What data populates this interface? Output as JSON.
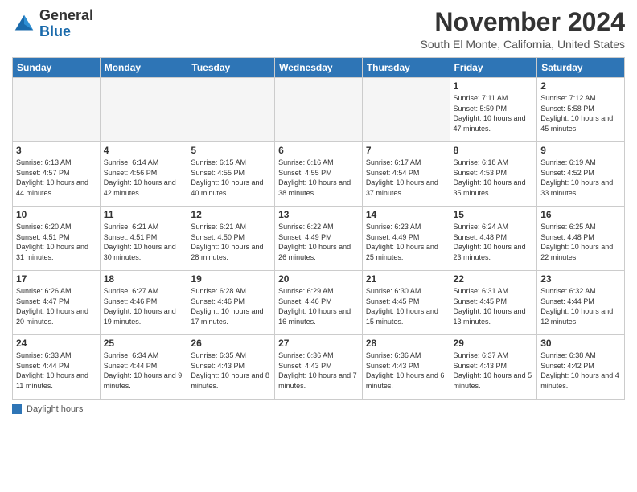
{
  "header": {
    "logo_general": "General",
    "logo_blue": "Blue",
    "month_title": "November 2024",
    "subtitle": "South El Monte, California, United States"
  },
  "calendar": {
    "days_of_week": [
      "Sunday",
      "Monday",
      "Tuesday",
      "Wednesday",
      "Thursday",
      "Friday",
      "Saturday"
    ],
    "weeks": [
      [
        {
          "day": "",
          "info": "",
          "empty": true
        },
        {
          "day": "",
          "info": "",
          "empty": true
        },
        {
          "day": "",
          "info": "",
          "empty": true
        },
        {
          "day": "",
          "info": "",
          "empty": true
        },
        {
          "day": "",
          "info": "",
          "empty": true
        },
        {
          "day": "1",
          "info": "Sunrise: 7:11 AM\nSunset: 5:59 PM\nDaylight: 10 hours and 47 minutes.",
          "empty": false
        },
        {
          "day": "2",
          "info": "Sunrise: 7:12 AM\nSunset: 5:58 PM\nDaylight: 10 hours and 45 minutes.",
          "empty": false
        }
      ],
      [
        {
          "day": "3",
          "info": "Sunrise: 6:13 AM\nSunset: 4:57 PM\nDaylight: 10 hours and 44 minutes.",
          "empty": false
        },
        {
          "day": "4",
          "info": "Sunrise: 6:14 AM\nSunset: 4:56 PM\nDaylight: 10 hours and 42 minutes.",
          "empty": false
        },
        {
          "day": "5",
          "info": "Sunrise: 6:15 AM\nSunset: 4:55 PM\nDaylight: 10 hours and 40 minutes.",
          "empty": false
        },
        {
          "day": "6",
          "info": "Sunrise: 6:16 AM\nSunset: 4:55 PM\nDaylight: 10 hours and 38 minutes.",
          "empty": false
        },
        {
          "day": "7",
          "info": "Sunrise: 6:17 AM\nSunset: 4:54 PM\nDaylight: 10 hours and 37 minutes.",
          "empty": false
        },
        {
          "day": "8",
          "info": "Sunrise: 6:18 AM\nSunset: 4:53 PM\nDaylight: 10 hours and 35 minutes.",
          "empty": false
        },
        {
          "day": "9",
          "info": "Sunrise: 6:19 AM\nSunset: 4:52 PM\nDaylight: 10 hours and 33 minutes.",
          "empty": false
        }
      ],
      [
        {
          "day": "10",
          "info": "Sunrise: 6:20 AM\nSunset: 4:51 PM\nDaylight: 10 hours and 31 minutes.",
          "empty": false
        },
        {
          "day": "11",
          "info": "Sunrise: 6:21 AM\nSunset: 4:51 PM\nDaylight: 10 hours and 30 minutes.",
          "empty": false
        },
        {
          "day": "12",
          "info": "Sunrise: 6:21 AM\nSunset: 4:50 PM\nDaylight: 10 hours and 28 minutes.",
          "empty": false
        },
        {
          "day": "13",
          "info": "Sunrise: 6:22 AM\nSunset: 4:49 PM\nDaylight: 10 hours and 26 minutes.",
          "empty": false
        },
        {
          "day": "14",
          "info": "Sunrise: 6:23 AM\nSunset: 4:49 PM\nDaylight: 10 hours and 25 minutes.",
          "empty": false
        },
        {
          "day": "15",
          "info": "Sunrise: 6:24 AM\nSunset: 4:48 PM\nDaylight: 10 hours and 23 minutes.",
          "empty": false
        },
        {
          "day": "16",
          "info": "Sunrise: 6:25 AM\nSunset: 4:48 PM\nDaylight: 10 hours and 22 minutes.",
          "empty": false
        }
      ],
      [
        {
          "day": "17",
          "info": "Sunrise: 6:26 AM\nSunset: 4:47 PM\nDaylight: 10 hours and 20 minutes.",
          "empty": false
        },
        {
          "day": "18",
          "info": "Sunrise: 6:27 AM\nSunset: 4:46 PM\nDaylight: 10 hours and 19 minutes.",
          "empty": false
        },
        {
          "day": "19",
          "info": "Sunrise: 6:28 AM\nSunset: 4:46 PM\nDaylight: 10 hours and 17 minutes.",
          "empty": false
        },
        {
          "day": "20",
          "info": "Sunrise: 6:29 AM\nSunset: 4:46 PM\nDaylight: 10 hours and 16 minutes.",
          "empty": false
        },
        {
          "day": "21",
          "info": "Sunrise: 6:30 AM\nSunset: 4:45 PM\nDaylight: 10 hours and 15 minutes.",
          "empty": false
        },
        {
          "day": "22",
          "info": "Sunrise: 6:31 AM\nSunset: 4:45 PM\nDaylight: 10 hours and 13 minutes.",
          "empty": false
        },
        {
          "day": "23",
          "info": "Sunrise: 6:32 AM\nSunset: 4:44 PM\nDaylight: 10 hours and 12 minutes.",
          "empty": false
        }
      ],
      [
        {
          "day": "24",
          "info": "Sunrise: 6:33 AM\nSunset: 4:44 PM\nDaylight: 10 hours and 11 minutes.",
          "empty": false
        },
        {
          "day": "25",
          "info": "Sunrise: 6:34 AM\nSunset: 4:44 PM\nDaylight: 10 hours and 9 minutes.",
          "empty": false
        },
        {
          "day": "26",
          "info": "Sunrise: 6:35 AM\nSunset: 4:43 PM\nDaylight: 10 hours and 8 minutes.",
          "empty": false
        },
        {
          "day": "27",
          "info": "Sunrise: 6:36 AM\nSunset: 4:43 PM\nDaylight: 10 hours and 7 minutes.",
          "empty": false
        },
        {
          "day": "28",
          "info": "Sunrise: 6:36 AM\nSunset: 4:43 PM\nDaylight: 10 hours and 6 minutes.",
          "empty": false
        },
        {
          "day": "29",
          "info": "Sunrise: 6:37 AM\nSunset: 4:43 PM\nDaylight: 10 hours and 5 minutes.",
          "empty": false
        },
        {
          "day": "30",
          "info": "Sunrise: 6:38 AM\nSunset: 4:42 PM\nDaylight: 10 hours and 4 minutes.",
          "empty": false
        }
      ]
    ]
  },
  "legend": {
    "text": "Daylight hours"
  }
}
